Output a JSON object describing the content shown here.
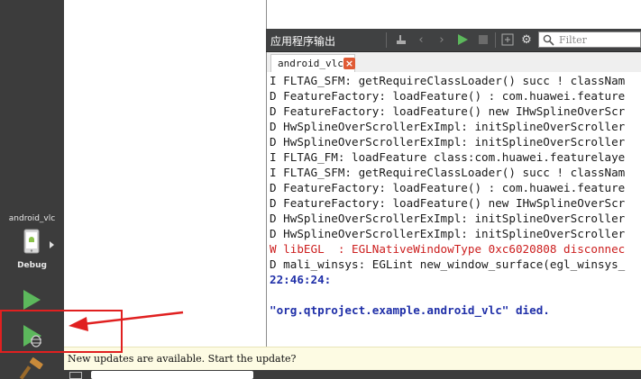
{
  "sidebar": {
    "kit_name": "android_vlc",
    "build_mode": "Debug",
    "run_icon": "run-icon",
    "debug_icon": "debug-run-icon",
    "build_icon": "hammer-icon"
  },
  "output": {
    "title": "应用程序输出",
    "filter_placeholder": "Filter",
    "tab_label": "android_vlc",
    "toolbar_icons": [
      "attach-icon",
      "chevron-left-icon",
      "chevron-right-icon",
      "rerun-icon",
      "stop-icon",
      "zoom-in-icon",
      "settings-icon",
      "search-icon"
    ],
    "lines": [
      {
        "text": "I FLTAG_SFM: getRequireClassLoader() succ ! classNam",
        "kind": "info"
      },
      {
        "text": "D FeatureFactory: loadFeature() : com.huawei.feature",
        "kind": "info"
      },
      {
        "text": "D FeatureFactory: loadFeature() new IHwSplineOverScr",
        "kind": "info"
      },
      {
        "text": "D HwSplineOverScrollerExImpl: initSplineOverScroller",
        "kind": "info"
      },
      {
        "text": "D HwSplineOverScrollerExImpl: initSplineOverScroller",
        "kind": "info"
      },
      {
        "text": "I FLTAG_FM: loadFeature class:com.huawei.featurelaye",
        "kind": "info"
      },
      {
        "text": "I FLTAG_SFM: getRequireClassLoader() succ ! classNam",
        "kind": "info"
      },
      {
        "text": "D FeatureFactory: loadFeature() : com.huawei.feature",
        "kind": "info"
      },
      {
        "text": "D FeatureFactory: loadFeature() new IHwSplineOverScr",
        "kind": "info"
      },
      {
        "text": "D HwSplineOverScrollerExImpl: initSplineOverScroller",
        "kind": "info"
      },
      {
        "text": "D HwSplineOverScrollerExImpl: initSplineOverScroller",
        "kind": "info"
      },
      {
        "text": "W libEGL  : EGLNativeWindowType 0xc6020808 disconnec",
        "kind": "warn"
      },
      {
        "text": "D mali_winsys: EGLint new_window_surface(egl_winsys_",
        "kind": "info"
      },
      {
        "text": "22:46:24:",
        "kind": "time"
      },
      {
        "text": "",
        "kind": "blank"
      },
      {
        "text": "\"org.qtproject.example.android_vlc\" died.",
        "kind": "died"
      }
    ]
  },
  "notification": {
    "text": "New updates are available. Start the update?"
  },
  "colors": {
    "annotation": "#e02020",
    "warn": "#cc1e1e",
    "time": "#1f2fa8",
    "run_green": "#5cb85c"
  }
}
